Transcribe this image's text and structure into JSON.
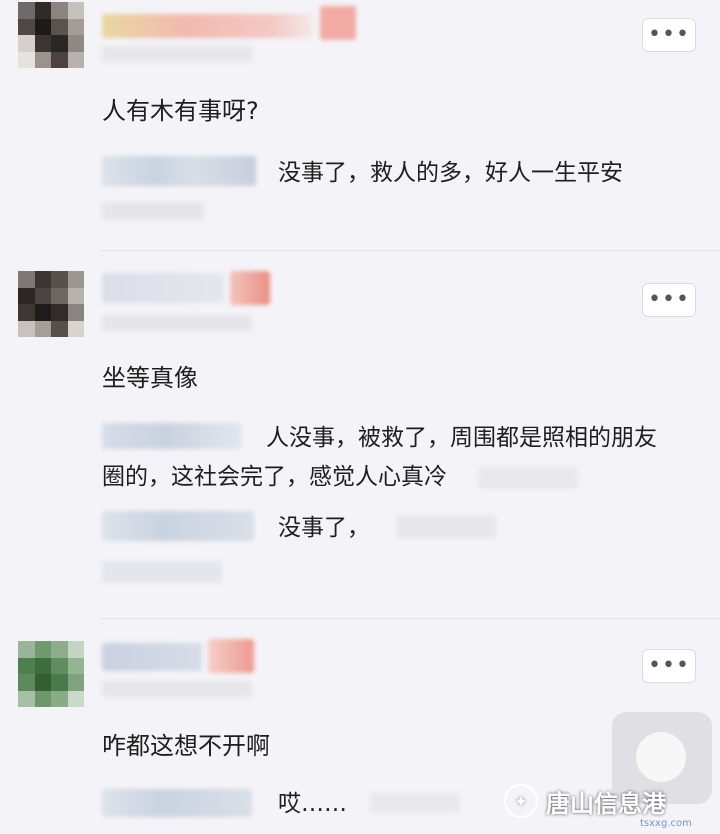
{
  "more_label": "•••",
  "comments": [
    {
      "text": "人有木有事呀?",
      "replies": [
        {
          "text": "没事了，救人的多，好人一生平安"
        }
      ]
    },
    {
      "text": "坐等真像",
      "replies": [
        {
          "text_line1": "人没事，被救了，周围都是照相的朋友",
          "text_line2": "圈的，这社会完了，感觉人心真冷"
        },
        {
          "text": "没事了，"
        }
      ]
    },
    {
      "text": "咋都这想不开啊",
      "replies": [
        {
          "text": "哎……"
        }
      ]
    }
  ],
  "watermark": {
    "name": "唐山信息港",
    "url": "tsxxg.com",
    "logo_icon": "wechat-icon"
  },
  "colors": {
    "background": "#f4f3f8",
    "text": "#1e1e1e",
    "more_button": "#ffffff"
  }
}
